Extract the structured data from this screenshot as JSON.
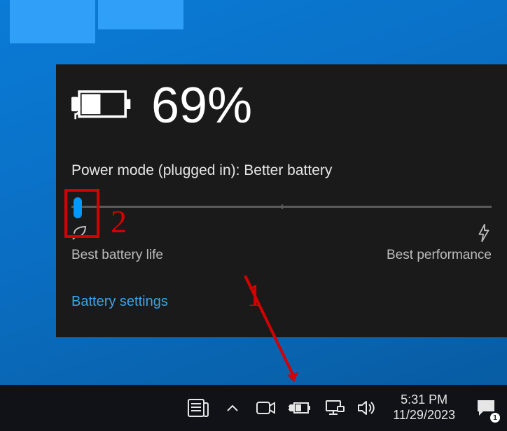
{
  "flyout": {
    "battery_percentage": "69%",
    "mode_label": "Power mode (plugged in): Better battery",
    "slider_min_label": "Best battery life",
    "slider_max_label": "Best performance",
    "settings_link": "Battery settings"
  },
  "taskbar": {
    "clock_time": "5:31 PM",
    "clock_date": "11/29/2023",
    "notification_count": "1"
  },
  "annotations": {
    "num1": "1",
    "num2": "2"
  },
  "icons": {
    "news": "news-icon",
    "tray_up": "chevron-up-icon",
    "meet_now": "camera-icon",
    "battery": "battery-charging-icon",
    "network": "network-icon",
    "volume": "speaker-icon",
    "action_center": "chat-icon",
    "leaf": "leaf-icon",
    "bolt": "bolt-icon",
    "plug": "plug-icon"
  }
}
